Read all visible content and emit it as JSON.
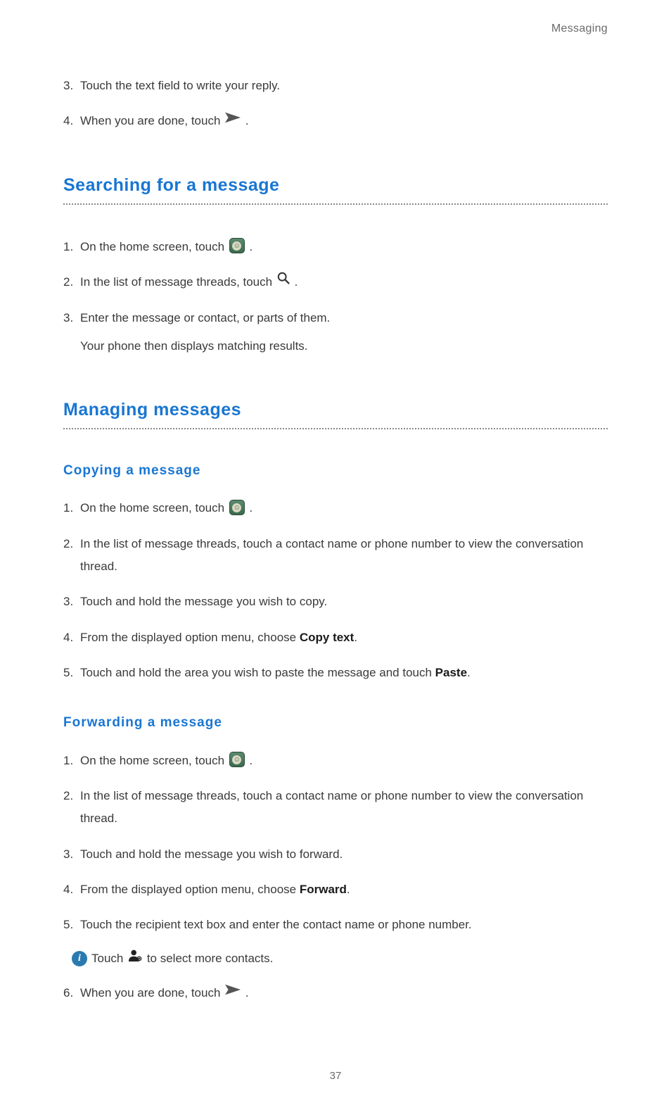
{
  "header": {
    "section": "Messaging"
  },
  "intro_steps": {
    "s3": {
      "num": "3.",
      "text": "Touch the text field to write your reply."
    },
    "s4": {
      "num": "4.",
      "text_before": "When you are done, touch ",
      "text_after": " ."
    }
  },
  "searching": {
    "title": "Searching for a message",
    "s1": {
      "num": "1.",
      "text_before": "On the home screen, touch ",
      "text_after": " ."
    },
    "s2": {
      "num": "2.",
      "text_before": "In the list of message threads, touch ",
      "text_after": " ."
    },
    "s3": {
      "num": "3.",
      "text": "Enter the message or contact, or parts of them."
    },
    "s3b": "Your phone then displays matching results."
  },
  "managing": {
    "title": "Managing messages",
    "copying": {
      "title": "Copying  a  message",
      "s1": {
        "num": "1.",
        "text_before": "On the home screen, touch ",
        "text_after": " ."
      },
      "s2": {
        "num": "2.",
        "text": "In the list of message threads, touch a contact name or phone number to view the conversation thread."
      },
      "s3": {
        "num": "3.",
        "text": "Touch and hold the message you wish to copy."
      },
      "s4": {
        "num": "4.",
        "text_before": "From the displayed option menu, choose ",
        "bold": "Copy text",
        "text_after": "."
      },
      "s5": {
        "num": "5.",
        "text_before": "Touch and hold the area you wish to paste the message and touch ",
        "bold": "Paste",
        "text_after": "."
      }
    },
    "forwarding": {
      "title": "Forwarding  a  message",
      "s1": {
        "num": "1.",
        "text_before": "On the home screen, touch ",
        "text_after": " ."
      },
      "s2": {
        "num": "2.",
        "text": "In the list of message threads, touch a contact name or phone number to view the conversation thread."
      },
      "s3": {
        "num": "3.",
        "text": "Touch and hold the message you wish to forward."
      },
      "s4": {
        "num": "4.",
        "text_before": "From the displayed option menu, choose ",
        "bold": "Forward",
        "text_after": "."
      },
      "s5": {
        "num": "5.",
        "text": "Touch the recipient text box and enter the contact name or phone number."
      },
      "info": {
        "text_before": "Touch ",
        "text_after": " to select more contacts."
      },
      "s6": {
        "num": "6.",
        "text_before": "When you are done, touch ",
        "text_after": " ."
      }
    }
  },
  "icons": {
    "send": "send-icon",
    "messaging": "messaging-app-icon",
    "search": "search-icon",
    "info": "info-icon",
    "add_contact": "add-contact-icon"
  },
  "page_number": "37"
}
